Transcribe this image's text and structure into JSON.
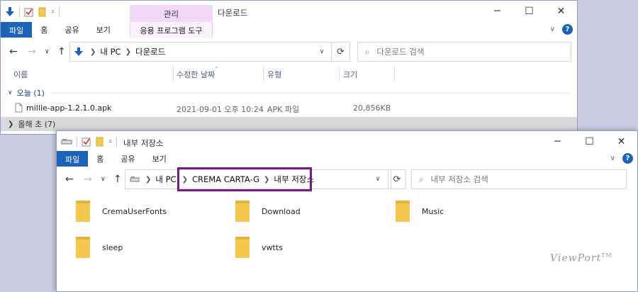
{
  "window1": {
    "title": "다운로드",
    "manage_label": "관리",
    "app_tools_label": "응용 프로그램 도구",
    "ribbon_tabs": [
      "파일",
      "홈",
      "공유",
      "보기"
    ],
    "address": [
      "내 PC",
      "다운로드"
    ],
    "search_placeholder": "다운로드 검색",
    "columns": [
      "이름",
      "수정한 날짜",
      "유형",
      "크기"
    ],
    "groups": {
      "today": "오늘 (1)",
      "earlier": "올해 초 (7)"
    },
    "files": [
      {
        "name": "millie-app-1.2.1.0.apk",
        "date": "2021-09-01 오후 10:24",
        "type": "APK 파일",
        "size": "20,856KB"
      }
    ]
  },
  "window2": {
    "title": "내부 저장소",
    "ribbon_tabs": [
      "파일",
      "홈",
      "공유",
      "보기"
    ],
    "address": [
      "내 PC",
      "CREMA CARTA-G",
      "내부 저장소"
    ],
    "search_placeholder": "내부 저장소 검색",
    "folders": [
      "CremaUserFonts",
      "Download",
      "Music",
      "sleep",
      "vwtts"
    ]
  },
  "watermark": {
    "text": "ViewPort",
    "mark": "TM"
  },
  "colors": {
    "accent": "#1c62b8",
    "highlight": "#7a1a8a",
    "folder": "#f4c84e"
  }
}
